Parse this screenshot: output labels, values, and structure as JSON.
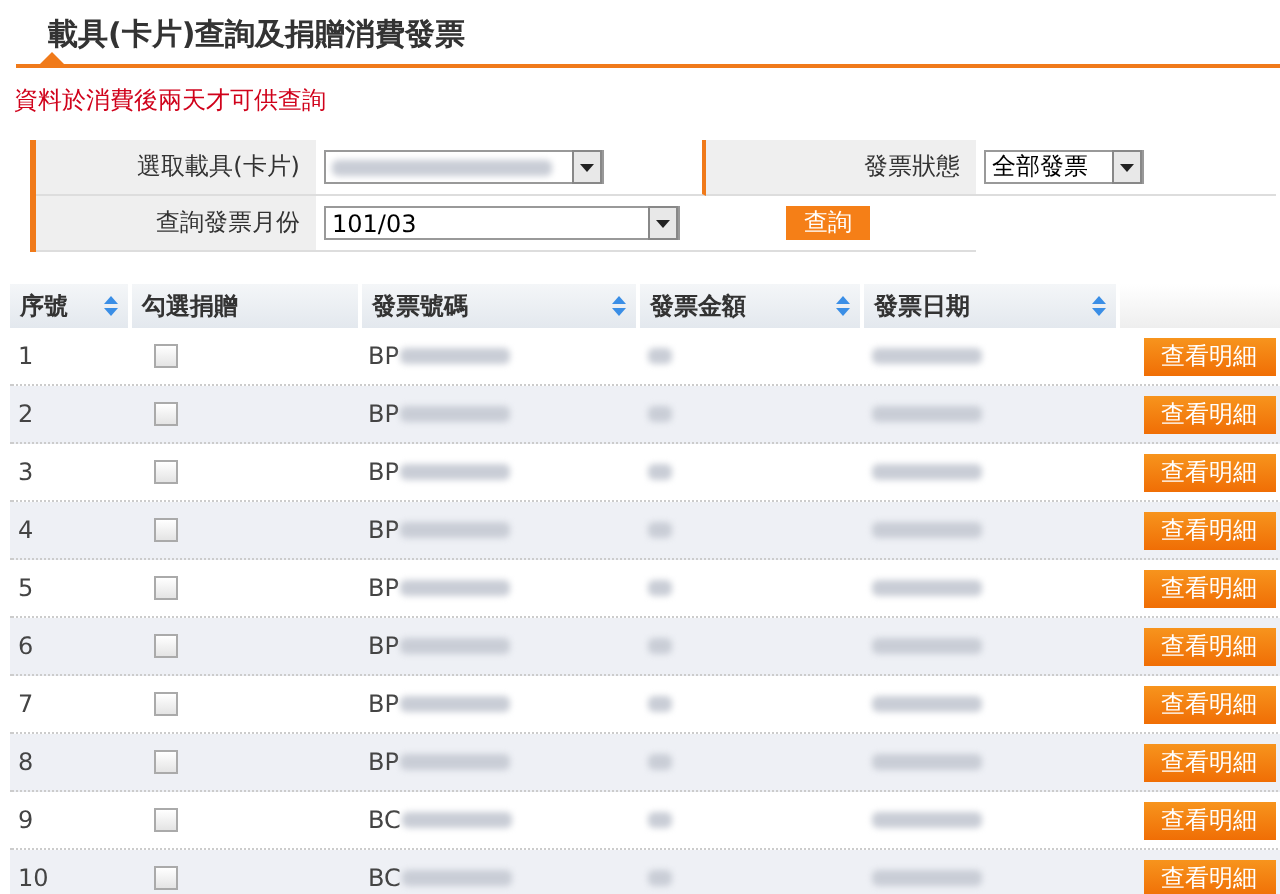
{
  "page_title": "載具(卡片)查詢及捐贈消費發票",
  "notice": "資料於消費後兩天才可供查詢",
  "form": {
    "fields": [
      {
        "label": "選取載具(卡片)",
        "kind": "blurred"
      },
      {
        "label": "發票狀態",
        "kind": "select",
        "value": "全部發票"
      },
      {
        "label": "查詢發票月份",
        "kind": "select",
        "value": "101/03"
      }
    ],
    "query_button": "查詢"
  },
  "table": {
    "columns": [
      {
        "label": "序號",
        "sortable": true
      },
      {
        "label": "勾選捐贈",
        "sortable": false
      },
      {
        "label": "發票號碼",
        "sortable": true
      },
      {
        "label": "發票金額",
        "sortable": true
      },
      {
        "label": "發票日期",
        "sortable": true
      }
    ],
    "rows": [
      {
        "no": "1",
        "checked": false,
        "invoice_prefix": "BP",
        "button": "查看明細"
      },
      {
        "no": "2",
        "checked": false,
        "invoice_prefix": "BP",
        "button": "查看明細"
      },
      {
        "no": "3",
        "checked": false,
        "invoice_prefix": "BP",
        "button": "查看明細"
      },
      {
        "no": "4",
        "checked": false,
        "invoice_prefix": "BP",
        "button": "查看明細"
      },
      {
        "no": "5",
        "checked": false,
        "invoice_prefix": "BP",
        "button": "查看明細"
      },
      {
        "no": "6",
        "checked": false,
        "invoice_prefix": "BP",
        "button": "查看明細"
      },
      {
        "no": "7",
        "checked": false,
        "invoice_prefix": "BP",
        "button": "查看明細"
      },
      {
        "no": "8",
        "checked": false,
        "invoice_prefix": "BP",
        "button": "查看明細"
      },
      {
        "no": "9",
        "checked": false,
        "invoice_prefix": "BC",
        "button": "查看明細"
      },
      {
        "no": "10",
        "checked": false,
        "invoice_prefix": "BC",
        "button": "查看明細"
      }
    ]
  }
}
